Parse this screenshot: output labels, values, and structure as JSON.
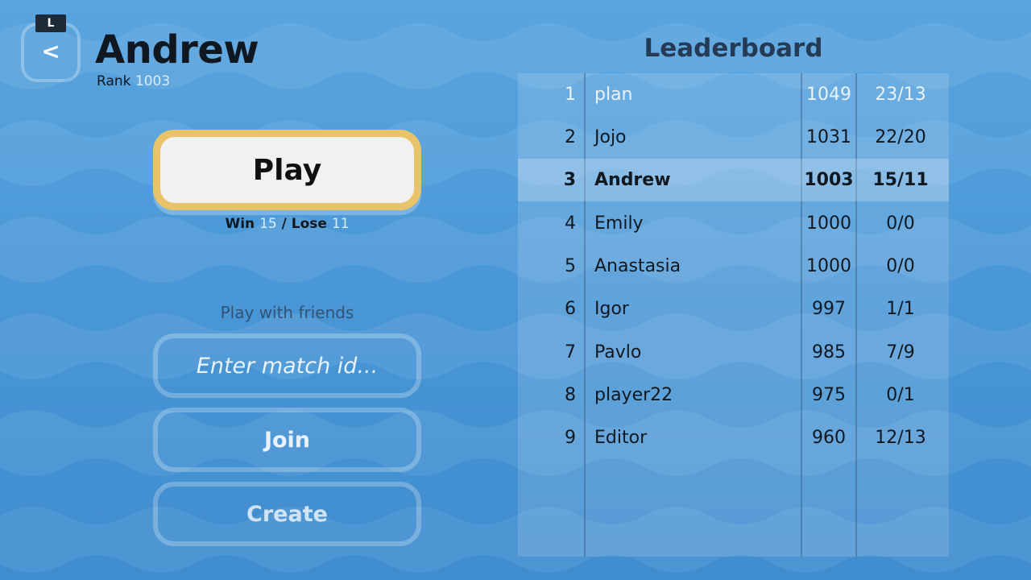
{
  "player": {
    "name": "Andrew",
    "rank_label": "Rank",
    "rank_value": "1003"
  },
  "back_button": {
    "label": "<",
    "key_hint": "L"
  },
  "play": {
    "label": "Play",
    "win_label": "Win",
    "win_value": "15",
    "separator": "/",
    "lose_label": "Lose",
    "lose_value": "11"
  },
  "friends": {
    "title": "Play with friends",
    "match_placeholder": "Enter match id...",
    "join_label": "Join",
    "create_label": "Create"
  },
  "leaderboard": {
    "title": "Leaderboard",
    "rows": [
      {
        "rank": "1",
        "name": "plan",
        "score": "1049",
        "record": "23/13"
      },
      {
        "rank": "2",
        "name": "Jojo",
        "score": "1031",
        "record": "22/20"
      },
      {
        "rank": "3",
        "name": "Andrew",
        "score": "1003",
        "record": "15/11"
      },
      {
        "rank": "4",
        "name": "Emily",
        "score": "1000",
        "record": "0/0"
      },
      {
        "rank": "5",
        "name": "Anastasia",
        "score": "1000",
        "record": "0/0"
      },
      {
        "rank": "6",
        "name": "Igor",
        "score": "997",
        "record": "1/1"
      },
      {
        "rank": "7",
        "name": "Pavlo",
        "score": "985",
        "record": "7/9"
      },
      {
        "rank": "8",
        "name": "player22",
        "score": "975",
        "record": "0/1"
      },
      {
        "rank": "9",
        "name": "Editor",
        "score": "960",
        "record": "12/13"
      }
    ]
  },
  "colors": {
    "background": "#4d9ad8",
    "play_border": "#e9c36a",
    "text_dark": "#0f1720",
    "accent_light": "#d8ecff"
  }
}
